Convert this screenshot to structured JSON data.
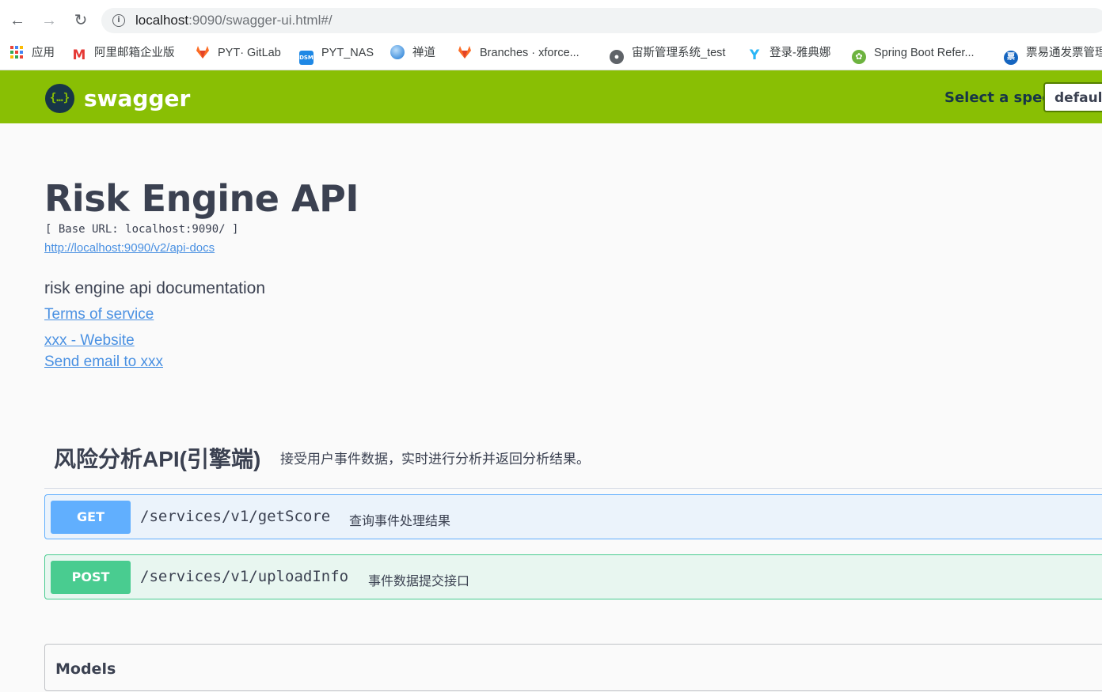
{
  "browser": {
    "url_host": "localhost",
    "url_rest": ":9090/swagger-ui.html#/",
    "bookmarks": [
      {
        "label": "应用",
        "icon": "apps-grid-icon",
        "color": "#4285f4"
      },
      {
        "label": "阿里邮箱企业版",
        "icon": "mail-m-icon",
        "color": "#e53935"
      },
      {
        "label": "PYT· GitLab",
        "icon": "gitlab-fox-icon",
        "color": "#fc6d26"
      },
      {
        "label": "PYT_NAS",
        "icon": "dsm-icon",
        "color": "#1e88e5"
      },
      {
        "label": "禅道",
        "icon": "globe-icon",
        "color": "#2196f3"
      },
      {
        "label": "Branches · xforce...",
        "icon": "gitlab-fox-icon",
        "color": "#fc6d26"
      },
      {
        "label": "宙斯管理系统_test",
        "icon": "world-icon",
        "color": "#5f6368"
      },
      {
        "label": "登录-雅典娜",
        "icon": "y-logo-icon",
        "color": "#29b6f6"
      },
      {
        "label": "Spring Boot Refer...",
        "icon": "spring-leaf-icon",
        "color": "#6db33f"
      },
      {
        "label": "票易通发票管理",
        "icon": "ticket-icon",
        "color": "#1565c0"
      }
    ]
  },
  "topbar": {
    "logo_text": "swagger",
    "logo_glyph": "{…}",
    "select_label": "Select a spec",
    "spec_value": "default",
    "color": "#89bf04"
  },
  "info": {
    "title": "Risk Engine API",
    "base_url": "[ Base URL: localhost:9090/ ]",
    "api_docs_link": "http://localhost:9090/v2/api-docs",
    "description": "risk engine api documentation",
    "terms": "Terms of service",
    "website": "xxx - Website",
    "email": "Send email to xxx"
  },
  "tag": {
    "name": "风险分析API(引擎端)",
    "description": "接受用户事件数据，实时进行分析并返回分析结果。"
  },
  "operations": [
    {
      "method": "GET",
      "path": "/services/v1/getScore",
      "summary": "查询事件处理结果",
      "color": "#61affe"
    },
    {
      "method": "POST",
      "path": "/services/v1/uploadInfo",
      "summary": "事件数据提交接口",
      "color": "#49cc90"
    }
  ],
  "models": {
    "title": "Models"
  }
}
